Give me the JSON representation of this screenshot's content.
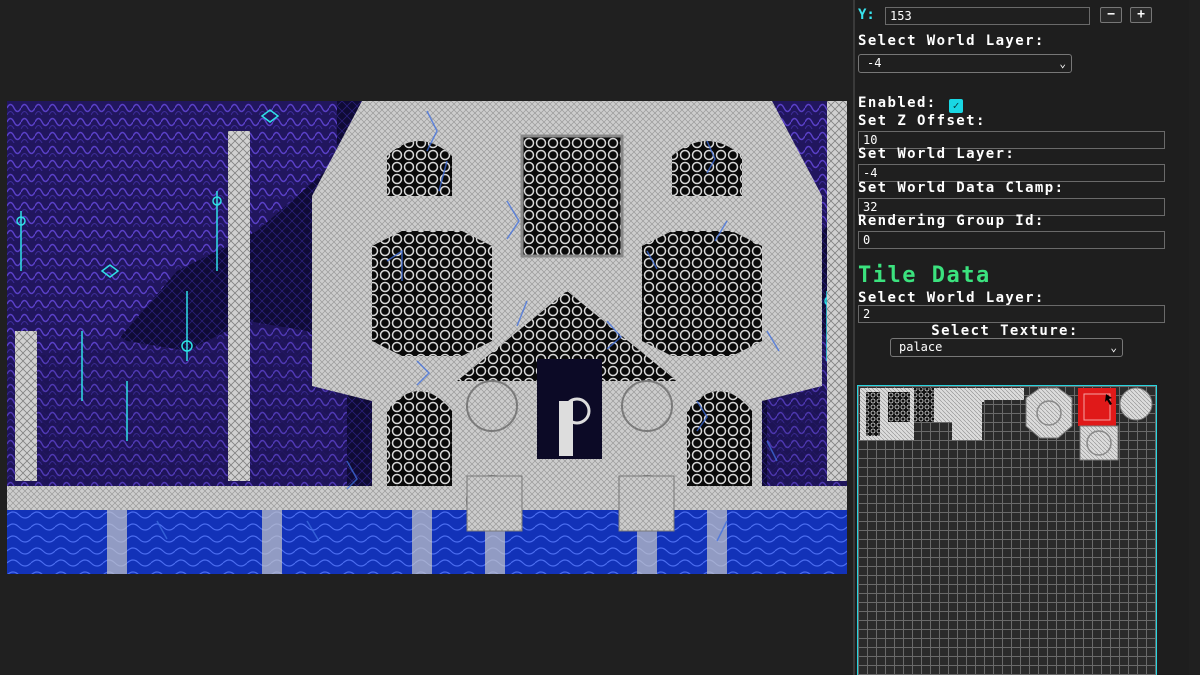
{
  "top": {
    "y_label": "Y:",
    "y_value": "153",
    "minus_label": "−",
    "plus_label": "+",
    "select_layer_label": "Select World Layer:",
    "select_layer_value": "-4"
  },
  "layer_settings": {
    "enabled_label": "Enabled:",
    "enabled": true,
    "z_offset_label": "Set Z Offset:",
    "z_offset_value": "10",
    "world_layer_label": "Set World Layer:",
    "world_layer_value": "-4",
    "data_clamp_label": "Set World Data Clamp:",
    "data_clamp_value": "32",
    "group_id_label": "Rendering Group Id:",
    "group_id_value": "0"
  },
  "tile_data": {
    "heading": "Tile Data",
    "world_layer_label": "Select World Layer:",
    "world_layer_value": "2",
    "texture_label": "Select Texture:",
    "texture_value": "palace"
  },
  "icons": {
    "dropdown": "chevron-down-icon",
    "checkbox": "check-icon",
    "scroll_up": "triangle-up-icon"
  },
  "colors": {
    "accent_cyan": "#38e4ee",
    "heading_green": "#3be27e",
    "selected_tile": "#e01919",
    "atlas_border": "#27d5e0",
    "scene_purple": "#2a1a6e",
    "scene_water": "#1030b8",
    "scene_stone": "#cfcfcf"
  }
}
